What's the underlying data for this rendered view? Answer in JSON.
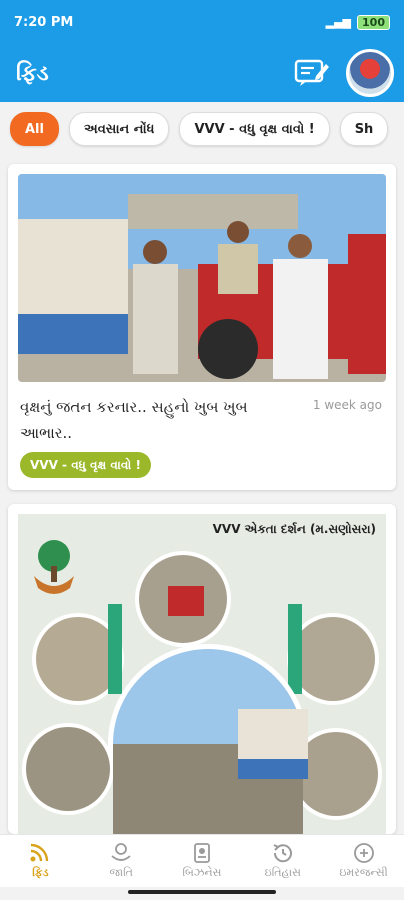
{
  "status": {
    "time": "7:20 PM",
    "battery": "100"
  },
  "app": {
    "title": "ફિડ"
  },
  "chips": [
    "All",
    "અવસાન નોંધ",
    "VVV - વધુ વૃક્ષ વાવો !",
    "Sh"
  ],
  "posts": [
    {
      "title": "વૃક્ષનું જતન કરનાર.. સહુનો ખુબ ખુબ આભાર..",
      "time": "1 week ago",
      "tag": "VVV - વધુ વૃક્ષ વાવો !"
    },
    {
      "caption": "VVV એકતા દર્શન (મ.સણોસરા)"
    }
  ],
  "nav": [
    "ફિડ",
    "જાતિ",
    "બિઝનેસ",
    "ઇતિહાસ",
    "ઇમરજન્સી"
  ],
  "colors": {
    "primary": "#1c9be6",
    "accent": "#f26a22",
    "tag": "#9bb82a",
    "active_nav": "#d9a21b"
  },
  "icons": {
    "compose": "edit-note-icon",
    "feed": "rss-icon",
    "caste": "hands-icon",
    "business": "badge-icon",
    "history": "history-icon",
    "emergency": "sos-icon"
  }
}
